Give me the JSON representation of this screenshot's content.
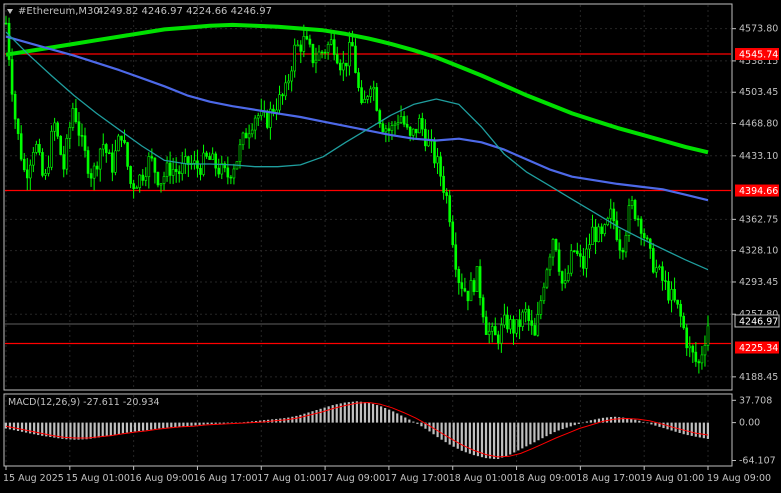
{
  "header": {
    "symbol_label": "#Ethereum,M30",
    "ohlc": "4249.82 4246.97 4224.66 4246.97",
    "menu_icon": "triangle-down-icon"
  },
  "price_axis": {
    "ticks": [
      "4573.80",
      "4538.15",
      "4503.45",
      "4468.80",
      "4433.10",
      "4362.75",
      "4328.10",
      "4293.45",
      "4257.80",
      "4188.45"
    ],
    "bubbles": {
      "resistance_upper": {
        "text": "4545.74",
        "bg": "#ff0000"
      },
      "resistance_lower": {
        "text": "4394.66",
        "bg": "#ff0000"
      },
      "current": {
        "text": "4246.97",
        "bg": "#000000"
      },
      "support": {
        "text": "4225.34",
        "bg": "#ff0000"
      }
    }
  },
  "macd": {
    "label": "MACD(12,26,9) -27.611 -20.934",
    "ticks": [
      "37.708",
      "0.00",
      "-64.107"
    ]
  },
  "time_axis": {
    "labels": [
      "15 Aug 2025",
      "15 Aug 01:00",
      "16 Aug 09:00",
      "16 Aug 17:00",
      "17 Aug 01:00",
      "17 Aug 09:00",
      "17 Aug 17:00",
      "18 Aug 01:00",
      "18 Aug 09:00",
      "18 Aug 17:00",
      "19 Aug 01:00",
      "19 Aug 09:00"
    ]
  },
  "chart_data": {
    "type": "line",
    "title": "",
    "ylim": [
      4175,
      4600
    ],
    "macd_ylim": [
      -70,
      45
    ],
    "horizontal_lines": [
      4545.74,
      4394.66,
      4225.34
    ],
    "series": [
      {
        "color": "#00e000",
        "values": [
          4545,
          4549,
          4553,
          4557,
          4561,
          4565,
          4569,
          4573,
          4575,
          4577,
          4578,
          4577,
          4576,
          4574,
          4572,
          4568,
          4563,
          4557,
          4550,
          4542,
          4532,
          4522,
          4511,
          4500,
          4490,
          4480,
          4472,
          4464,
          4457,
          4450,
          4443,
          4437
        ]
      },
      {
        "color": "#4d69e8",
        "values": [
          4565,
          4558,
          4551,
          4544,
          4536,
          4528,
          4519,
          4510,
          4500,
          4493,
          4488,
          4484,
          4480,
          4476,
          4471,
          4466,
          4461,
          4456,
          4452,
          4450,
          4452,
          4448,
          4440,
          4429,
          4418,
          4410,
          4406,
          4402,
          4399,
          4396,
          4390,
          4384
        ]
      },
      {
        "color": "#1f9e9e",
        "values": [
          4570,
          4545,
          4522,
          4500,
          4480,
          4462,
          4444,
          4428,
          4424,
          4424,
          4423,
          4421,
          4421,
          4423,
          4432,
          4448,
          4463,
          4478,
          4490,
          4496,
          4490,
          4465,
          4435,
          4415,
          4400,
          4385,
          4370,
          4355,
          4342,
          4330,
          4318,
          4307
        ]
      }
    ],
    "price_path": [
      4580,
      4470,
      4410,
      4450,
      4400,
      4470,
      4420,
      4490,
      4440,
      4410,
      4450,
      4420,
      4460,
      4400,
      4410,
      4430,
      4405,
      4420,
      4415,
      4425,
      4420,
      4430,
      4420,
      4410,
      4430,
      4460,
      4480,
      4470,
      4490,
      4500,
      4550,
      4560,
      4540,
      4550,
      4560,
      4530,
      4555,
      4480,
      4520,
      4470,
      4460,
      4480,
      4450,
      4470,
      4445,
      4420,
      4380,
      4300,
      4280,
      4300,
      4240,
      4230,
      4250,
      4240,
      4260,
      4230,
      4300,
      4350,
      4280,
      4330,
      4310,
      4350,
      4340,
      4370,
      4330,
      4380,
      4360,
      4320,
      4300,
      4280,
      4260,
      4220,
      4200,
      4246.97
    ],
    "macd_histogram": [
      -10,
      -14,
      -18,
      -22,
      -25,
      -28,
      -29,
      -28,
      -25,
      -22,
      -18,
      -15,
      -13,
      -10,
      -8,
      -7,
      -5,
      -3,
      -2,
      -1,
      0,
      2,
      4,
      6,
      8,
      12,
      18,
      24,
      30,
      34,
      36,
      34,
      28,
      20,
      10,
      0,
      -12,
      -26,
      -38,
      -48,
      -55,
      -60,
      -62,
      -55,
      -45,
      -35,
      -25,
      -15,
      -8,
      -2,
      4,
      8,
      10,
      8,
      4,
      -2,
      -8,
      -14,
      -20,
      -24,
      -27.611
    ],
    "macd_signal": [
      -6,
      -10,
      -14,
      -18,
      -22,
      -25,
      -26,
      -26,
      -24,
      -22,
      -19,
      -16,
      -14,
      -11,
      -9,
      -7,
      -6,
      -4,
      -3,
      -2,
      -1,
      0,
      1,
      3,
      5,
      8,
      13,
      18,
      24,
      29,
      33,
      34,
      31,
      25,
      17,
      8,
      -3,
      -15,
      -27,
      -38,
      -47,
      -54,
      -58,
      -57,
      -52,
      -44,
      -35,
      -26,
      -18,
      -10,
      -4,
      2,
      6,
      7,
      6,
      3,
      -2,
      -8,
      -13,
      -18,
      -20.934
    ]
  },
  "colors": {
    "background": "#000000",
    "grid": "#262626",
    "axis": "#c0c0c0",
    "candle": "#00ff00",
    "hline": "#ff0000",
    "histogram": "#c0c0c0",
    "signal": "#ff0000"
  }
}
